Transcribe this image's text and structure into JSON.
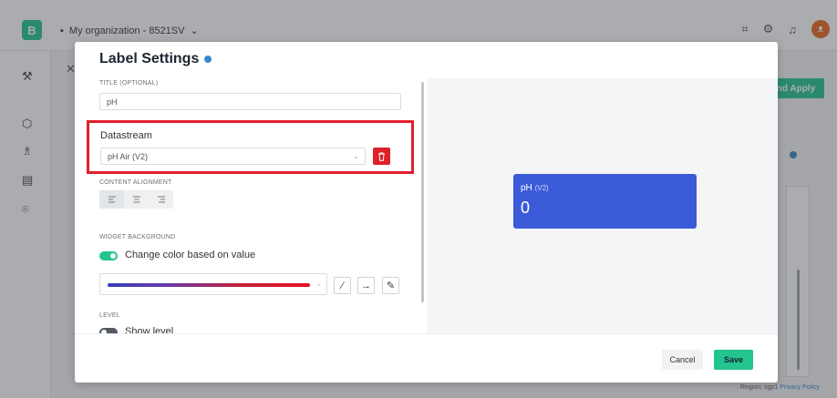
{
  "background": {
    "logo": "B",
    "org_name": "My organization - 8521SV",
    "apply_label": "nd Apply",
    "region": "Region: sgp1",
    "privacy": "Privacy Policy"
  },
  "modal": {
    "title": "Label Settings",
    "title_field": {
      "label": "TITLE (OPTIONAL)",
      "value": "pH"
    },
    "datastream": {
      "label": "Datastream",
      "value": "pH Air (V2)"
    },
    "content_alignment": {
      "label": "CONTENT ALIGNMENT",
      "selected": "left"
    },
    "widget_background": {
      "label": "WIDGET BACKGROUND",
      "toggle_label": "Change color based on value",
      "enabled": true
    },
    "level": {
      "label": "LEVEL",
      "toggle_label": "Show level",
      "enabled": false
    },
    "preview": {
      "title": "pH",
      "pin": "(V2)",
      "value": "0",
      "color": "#3b5bd9"
    },
    "footer": {
      "cancel": "Cancel",
      "save": "Save"
    }
  },
  "colors": {
    "accent": "#23c48e",
    "danger": "#e0202b",
    "info": "#3b88c9"
  }
}
